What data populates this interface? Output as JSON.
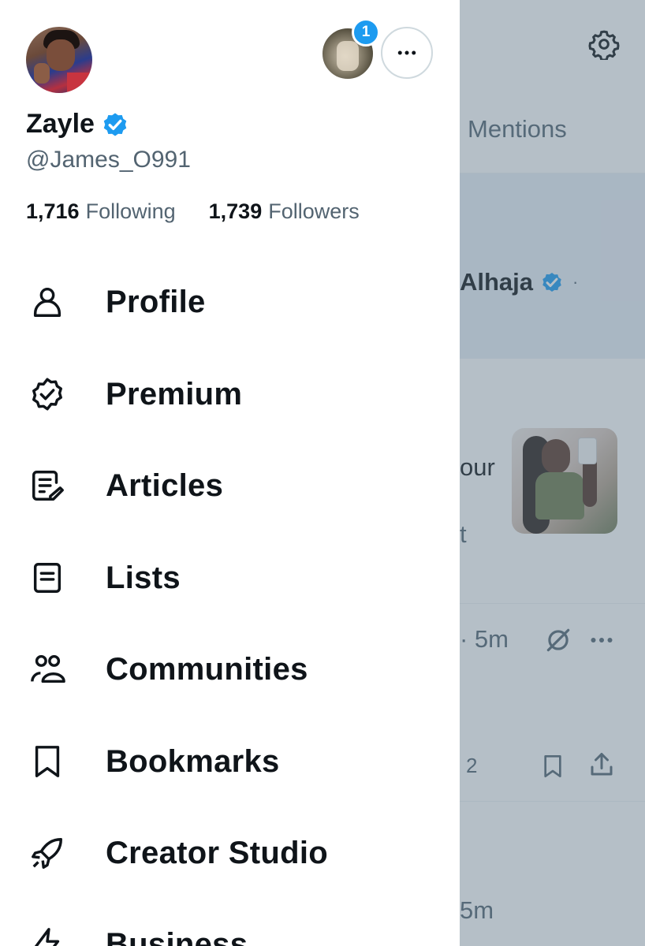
{
  "profile": {
    "display_name": "Zayle",
    "handle": "@James_O991",
    "following_count": "1,716",
    "following_label": "Following",
    "followers_count": "1,739",
    "followers_label": "Followers",
    "notification_badge": "1"
  },
  "menu": {
    "items": [
      {
        "label": "Profile",
        "icon": "person-icon"
      },
      {
        "label": "Premium",
        "icon": "verified-badge-icon"
      },
      {
        "label": "Articles",
        "icon": "article-edit-icon"
      },
      {
        "label": "Lists",
        "icon": "list-icon"
      },
      {
        "label": "Communities",
        "icon": "people-icon"
      },
      {
        "label": "Bookmarks",
        "icon": "bookmark-icon"
      },
      {
        "label": "Creator Studio",
        "icon": "rocket-icon"
      },
      {
        "label": "Business",
        "icon": "lightning-icon"
      }
    ]
  },
  "background": {
    "tab_label": "Mentions",
    "author": "Alhaja",
    "separator": "·",
    "text_fragment": "our",
    "text_fragment_2": "t",
    "timestamp": "· 5m",
    "reply_count": "2",
    "timestamp_2": "5m"
  },
  "colors": {
    "accent": "#1d9bf0",
    "text_primary": "#0f1419",
    "text_secondary": "#536471",
    "overlay": "#5b7083"
  }
}
